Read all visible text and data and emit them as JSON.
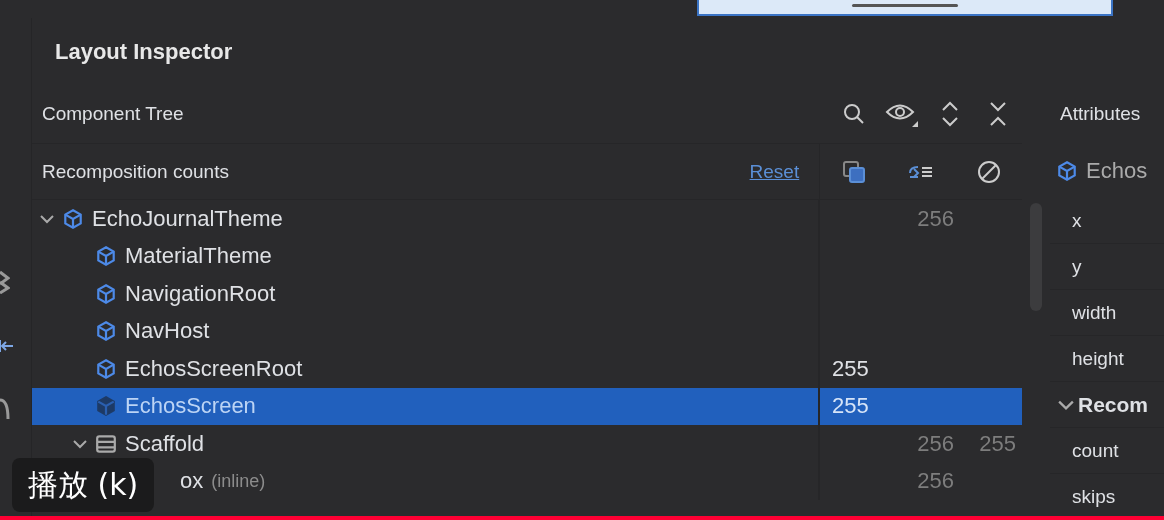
{
  "title": "Layout Inspector",
  "component_tree": {
    "title": "Component Tree",
    "recomposition_label": "Recomposition counts",
    "reset_link": "Reset",
    "nodes": [
      {
        "name": "EchoJournalTheme",
        "kind": "component",
        "expanded": true,
        "selected": false,
        "counts": {
          "col_2": "256"
        },
        "children": [
          {
            "name": "MaterialTheme",
            "kind": "component",
            "selected": false
          },
          {
            "name": "NavigationRoot",
            "kind": "component",
            "selected": false
          },
          {
            "name": "NavHost",
            "kind": "component",
            "selected": false
          },
          {
            "name": "EchosScreenRoot",
            "kind": "component",
            "selected": false,
            "counts": {
              "col_1": "255"
            }
          },
          {
            "name": "EchosScreen",
            "kind": "component",
            "selected": true,
            "counts": {
              "col_1": "255"
            }
          },
          {
            "name": "Scaffold",
            "kind": "layout",
            "expanded": true,
            "selected": false,
            "counts": {
              "col_2": "256",
              "col_3": "255"
            },
            "children": [
              {
                "name": "ox",
                "suffix": "(inline)",
                "selected": false,
                "counts": {
                  "col_2": "256"
                }
              }
            ]
          }
        ]
      }
    ]
  },
  "attributes": {
    "title": "Attributes",
    "component": "Echos",
    "rows": [
      {
        "kind": "field",
        "label": "x"
      },
      {
        "kind": "field",
        "label": "y"
      },
      {
        "kind": "field",
        "label": "width"
      },
      {
        "kind": "field",
        "label": "height"
      },
      {
        "kind": "section",
        "label": "Recom",
        "expanded": true
      },
      {
        "kind": "field",
        "label": "count"
      },
      {
        "kind": "field",
        "label": "skips"
      }
    ]
  },
  "player": {
    "tooltip": "播放 (k)",
    "progress": {
      "level": 1
    }
  }
}
